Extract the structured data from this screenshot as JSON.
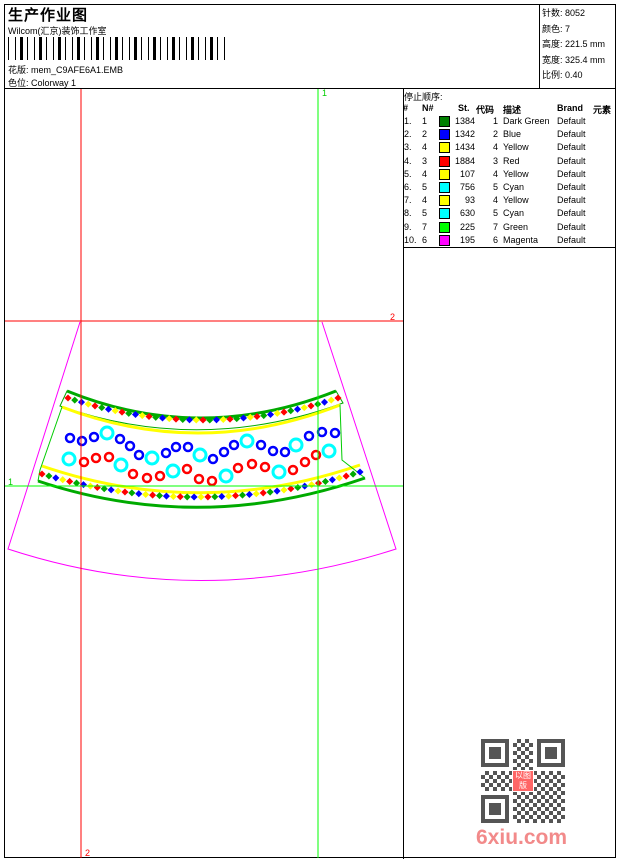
{
  "header": {
    "title": "生产作业图",
    "company": "Wilcom(汇京)装饰工作室",
    "design_label": "花版:",
    "design_value": "mem_C9AFE6A1.EMB",
    "colorway_label": "色位:",
    "colorway_value": "Colorway 1"
  },
  "stats": [
    {
      "label": "针数:",
      "value": "8052"
    },
    {
      "label": "颜色:",
      "value": "7"
    },
    {
      "label": "高度:",
      "value": "221.5 mm"
    },
    {
      "label": "宽度:",
      "value": "325.4 mm"
    },
    {
      "label": "比例:",
      "value": "0.40"
    }
  ],
  "stop_sequence": {
    "title": "停止顺序:",
    "headers": {
      "num": "#",
      "needle": "N#",
      "stitches": "St.",
      "code": "代码",
      "desc": "描述",
      "brand": "Brand",
      "element": "元素"
    },
    "rows": [
      {
        "num": "1.",
        "needle": "1",
        "color": "#008000",
        "stitches": "1384",
        "code": "1",
        "desc": "Dark Green",
        "brand": "Default"
      },
      {
        "num": "2.",
        "needle": "2",
        "color": "#0000ff",
        "stitches": "1342",
        "code": "2",
        "desc": "Blue",
        "brand": "Default"
      },
      {
        "num": "3.",
        "needle": "4",
        "color": "#ffff00",
        "stitches": "1434",
        "code": "4",
        "desc": "Yellow",
        "brand": "Default"
      },
      {
        "num": "4.",
        "needle": "3",
        "color": "#ff0000",
        "stitches": "1884",
        "code": "3",
        "desc": "Red",
        "brand": "Default"
      },
      {
        "num": "5.",
        "needle": "4",
        "color": "#ffff00",
        "stitches": "107",
        "code": "4",
        "desc": "Yellow",
        "brand": "Default"
      },
      {
        "num": "6.",
        "needle": "5",
        "color": "#00ffff",
        "stitches": "756",
        "code": "5",
        "desc": "Cyan",
        "brand": "Default"
      },
      {
        "num": "7.",
        "needle": "4",
        "color": "#ffff00",
        "stitches": "93",
        "code": "4",
        "desc": "Yellow",
        "brand": "Default"
      },
      {
        "num": "8.",
        "needle": "5",
        "color": "#00ffff",
        "stitches": "630",
        "code": "5",
        "desc": "Cyan",
        "brand": "Default"
      },
      {
        "num": "9.",
        "needle": "7",
        "color": "#00ff00",
        "stitches": "225",
        "code": "7",
        "desc": "Green",
        "brand": "Default"
      },
      {
        "num": "10.",
        "needle": "6",
        "color": "#ff00ff",
        "stitches": "195",
        "code": "6",
        "desc": "Magenta",
        "brand": "Default"
      }
    ]
  },
  "guides": {
    "v1": "1",
    "h2": "2",
    "h1": "1",
    "v2": "2"
  },
  "watermark": {
    "text": "6xiu.com",
    "seal": "以图版"
  }
}
